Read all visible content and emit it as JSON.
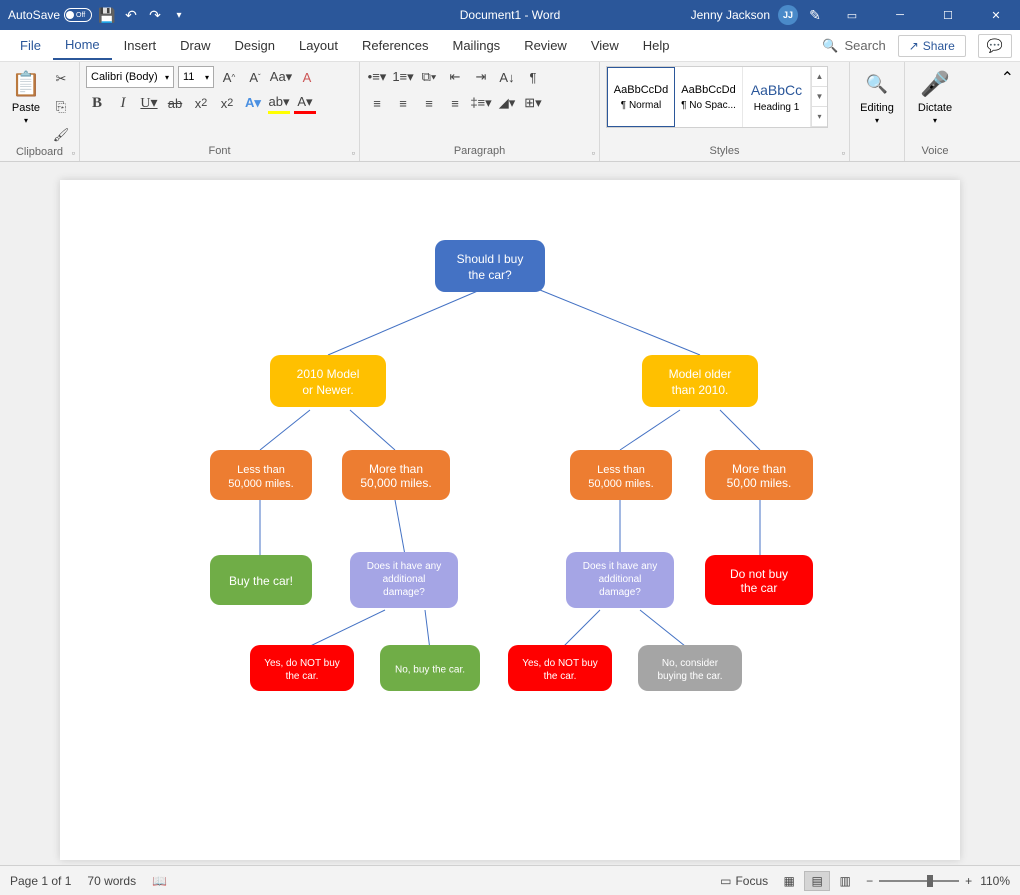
{
  "titlebar": {
    "autosave_label": "AutoSave",
    "autosave_state": "Off",
    "doc_title": "Document1 - Word",
    "user_name": "Jenny Jackson",
    "user_initials": "JJ"
  },
  "tabs": {
    "file": "File",
    "home": "Home",
    "insert": "Insert",
    "draw": "Draw",
    "design": "Design",
    "layout": "Layout",
    "references": "References",
    "mailings": "Mailings",
    "review": "Review",
    "view": "View",
    "help": "Help",
    "search": "Search",
    "share": "Share"
  },
  "ribbon": {
    "clipboard": {
      "label": "Clipboard",
      "paste": "Paste"
    },
    "font": {
      "label": "Font",
      "name": "Calibri (Body)",
      "size": "11"
    },
    "paragraph": {
      "label": "Paragraph"
    },
    "styles": {
      "label": "Styles",
      "items": [
        {
          "preview": "AaBbCcDd",
          "name": "¶ Normal"
        },
        {
          "preview": "AaBbCcDd",
          "name": "¶ No Spac..."
        },
        {
          "preview": "AaBbCc",
          "name": "Heading 1"
        }
      ]
    },
    "editing": {
      "label": "Editing",
      "btn": "Editing"
    },
    "voice": {
      "label": "Voice",
      "btn": "Dictate"
    }
  },
  "chart_data": {
    "type": "tree",
    "nodes": {
      "root": {
        "text": "Should I buy the car?",
        "color": "#4472c4"
      },
      "left1": {
        "text": "2010 Model or Newer.",
        "color": "#ffc000"
      },
      "right1": {
        "text": "Model older than 2010.",
        "color": "#ffc000"
      },
      "ll2": {
        "text": "Less than 50,000 miles.",
        "color": "#ed7d31"
      },
      "lr2": {
        "text": "More than 50,000 miles.",
        "color": "#ed7d31"
      },
      "rl2": {
        "text": "Less than 50,000 miles.",
        "color": "#ed7d31"
      },
      "rr2": {
        "text": "More than 50,00 miles.",
        "color": "#ed7d31"
      },
      "lll3": {
        "text": "Buy the car!",
        "color": "#70ad47"
      },
      "llr3": {
        "text": "Does it have any additional damage?",
        "color": "#a5a5e5"
      },
      "rrl3": {
        "text": "Does it have any additional damage?",
        "color": "#a5a5e5"
      },
      "rrr3": {
        "text": "Do not buy the car",
        "color": "#ff0000"
      },
      "leaf1": {
        "text": "Yes, do NOT buy the car.",
        "color": "#ff0000"
      },
      "leaf2": {
        "text": "No, buy the car.",
        "color": "#70ad47"
      },
      "leaf3": {
        "text": "Yes, do NOT buy the car.",
        "color": "#ff0000"
      },
      "leaf4": {
        "text": "No, consider buying the car.",
        "color": "#a5a5a5"
      }
    }
  },
  "statusbar": {
    "page": "Page 1 of 1",
    "words": "70 words",
    "focus": "Focus",
    "zoom": "110%"
  }
}
